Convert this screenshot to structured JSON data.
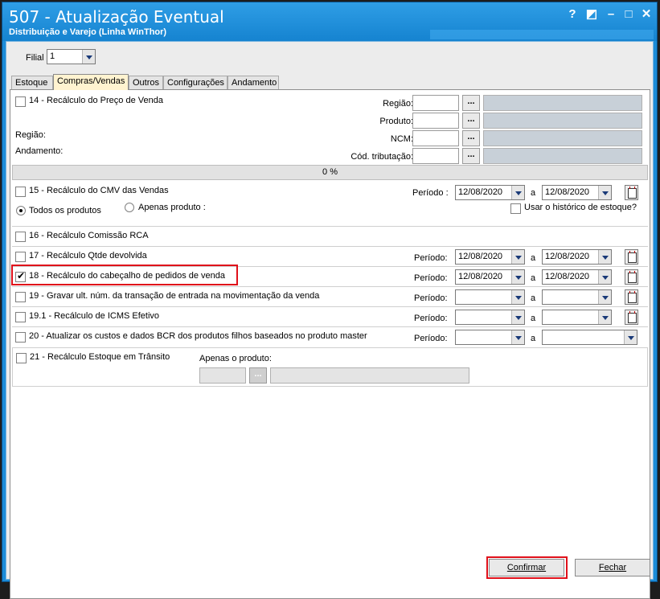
{
  "window": {
    "title": "507 - Atualização Eventual",
    "subtitle": "Distribuição e Varejo (Linha WinThor)",
    "help_glyph": "?",
    "edit_glyph": "◩",
    "minimize_glyph": "–",
    "maximize_glyph": "□",
    "close_glyph": "✕"
  },
  "filial": {
    "label": "Filial",
    "value": "1"
  },
  "tabs": [
    {
      "label": "Estoque"
    },
    {
      "label": "Compras/Vendas",
      "active": true
    },
    {
      "label": "Outros"
    },
    {
      "label": "Configurações"
    },
    {
      "label": "Andamento"
    }
  ],
  "s14": {
    "label": "14 - Recálculo do Preço de Venda",
    "fields": [
      "Região:",
      "Produto:",
      "NCM:",
      "Cód. tributação:"
    ],
    "ellipsis": "...",
    "info_regiao": "Região:",
    "info_andamento": "Andamento:",
    "progress": "0 %"
  },
  "s15": {
    "label": "15 - Recálculo do CMV das Vendas",
    "periodo": "Período :",
    "a": "a",
    "date_from": "12/08/2020",
    "date_to": "12/08/2020",
    "radio_all": "Todos os produtos",
    "radio_only": "Apenas produto :",
    "use_history": "Usar o histórico de estoque?"
  },
  "s16": {
    "label": "16 - Recálculo Comissão RCA"
  },
  "rows": {
    "periodo": "Período:",
    "a": "a",
    "r17": {
      "label": "17 - Recálculo Qtde devolvida",
      "date_from": "12/08/2020",
      "date_to": "12/08/2020"
    },
    "r18": {
      "label": "18 - Recálculo do cabeçalho de pedidos de venda",
      "date_from": "12/08/2020",
      "date_to": "12/08/2020"
    },
    "r19": {
      "label": "19 - Gravar ult. núm. da transação de entrada na movimentação da venda"
    },
    "r191": {
      "label": "19.1 - Recálculo de ICMS Efetivo"
    },
    "r20": {
      "label": "20 - Atualizar os custos e dados BCR dos produtos filhos baseados no produto master"
    }
  },
  "s21": {
    "label": "21 - Recálculo Estoque em Trânsito",
    "apenas": "Apenas o produto:",
    "ellipsis": "..."
  },
  "buttons": {
    "confirm": "Confirmar",
    "close": "Fechar"
  },
  "colors": {
    "title_bar": "#1c8cd8",
    "highlight": "#e0101a",
    "active_tab": "#fff3d0"
  }
}
